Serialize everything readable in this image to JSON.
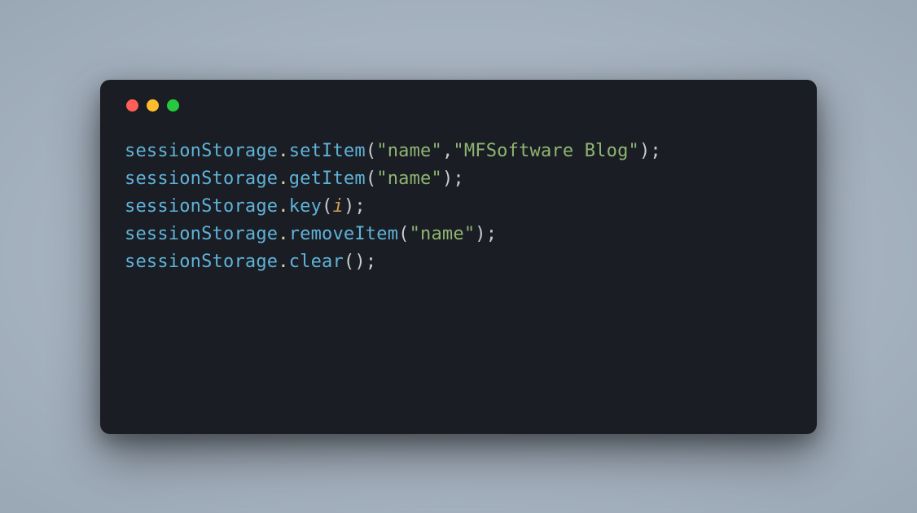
{
  "colors": {
    "close": "#ff5f56",
    "minimize": "#ffbd2e",
    "zoom": "#27c93f",
    "background": "#1a1d23"
  },
  "code": {
    "lines": [
      {
        "object": "sessionStorage",
        "method": "setItem",
        "args": [
          {
            "type": "string",
            "value": "\"name\""
          },
          {
            "type": "string",
            "value": "\"MFSoftware Blog\""
          }
        ]
      },
      {
        "object": "sessionStorage",
        "method": "getItem",
        "args": [
          {
            "type": "string",
            "value": "\"name\""
          }
        ]
      },
      {
        "object": "sessionStorage",
        "method": "key",
        "args": [
          {
            "type": "ident",
            "value": "i"
          }
        ]
      },
      {
        "object": "sessionStorage",
        "method": "removeItem",
        "args": [
          {
            "type": "string",
            "value": "\"name\""
          }
        ]
      },
      {
        "object": "sessionStorage",
        "method": "clear",
        "args": []
      }
    ]
  }
}
